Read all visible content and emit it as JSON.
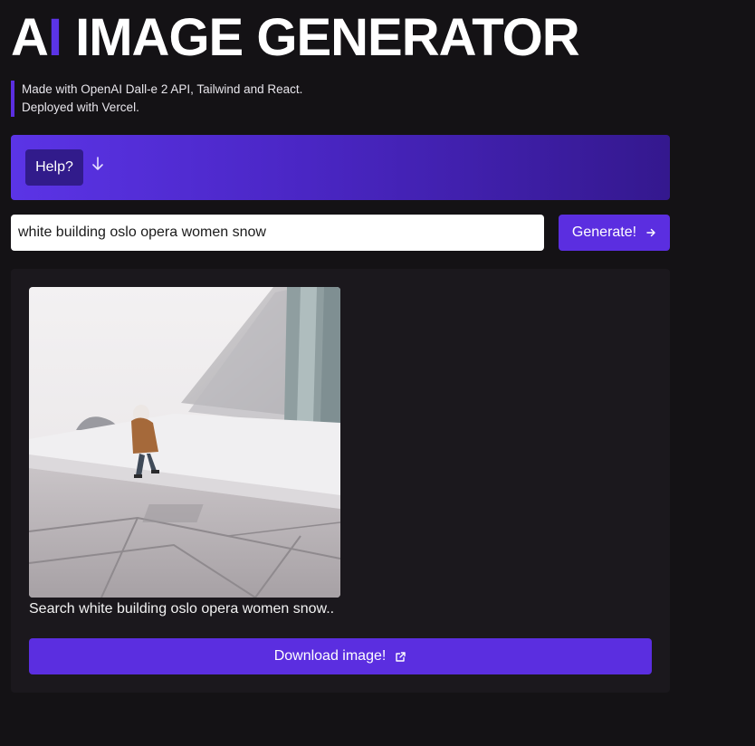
{
  "header": {
    "title_prefix": "A",
    "title_bar": "I",
    "title_rest": " IMAGE GENERATOR"
  },
  "info": {
    "line1": "Made with OpenAI Dall-e 2 API, Tailwind and React.",
    "line2": "Deployed with Vercel."
  },
  "help": {
    "label": "Help?",
    "icon": "arrow-down-icon"
  },
  "search": {
    "value": "white building oslo opera women snow"
  },
  "generate": {
    "label": "Generate!",
    "icon": "arrow-right-icon"
  },
  "result": {
    "caption": "Search white building oslo opera women snow..",
    "download_label": "Download image!",
    "download_icon": "external-link-icon"
  },
  "colors": {
    "background": "#141215",
    "accent": "#5b2ee0",
    "card": "#1b181d",
    "help_button": "#311b8b"
  }
}
